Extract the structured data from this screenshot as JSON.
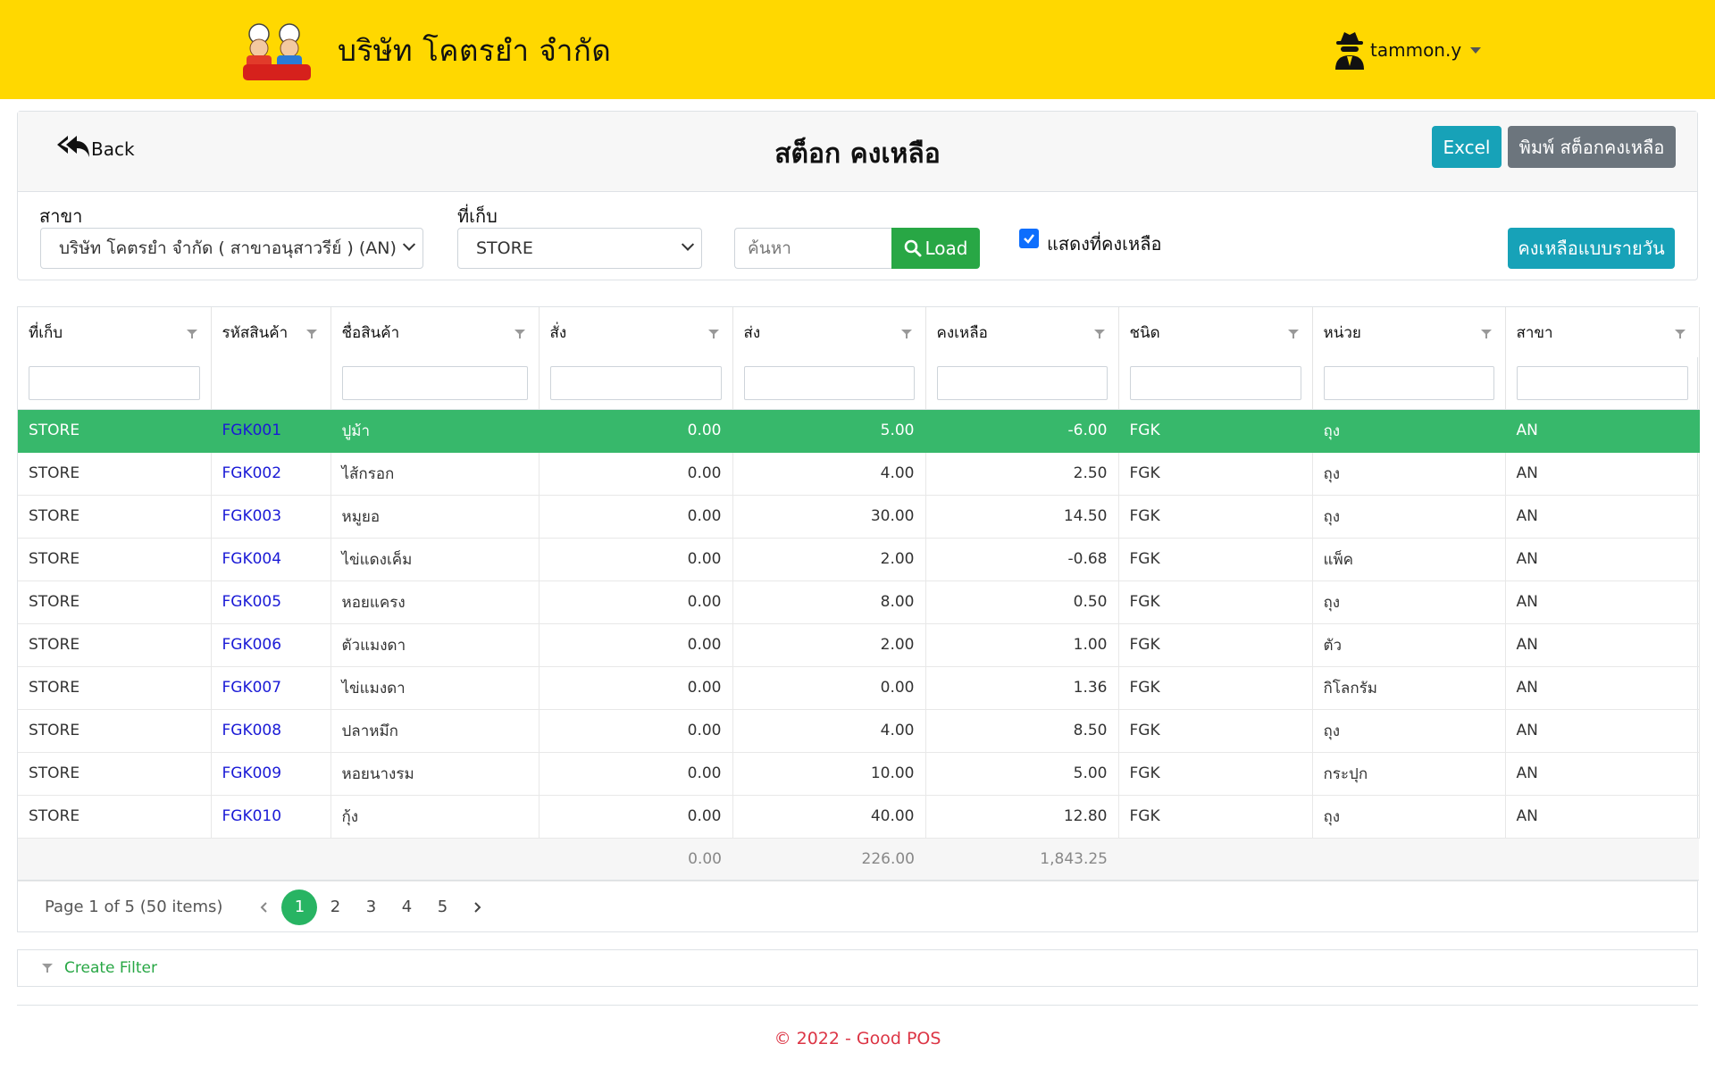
{
  "header": {
    "company_name": "บริษัท โคตรยำ จำกัด",
    "logo_text": "โคตรยำ",
    "user_name": "tammon.y"
  },
  "toolbar": {
    "back_label": "Back",
    "title": "สต็อก คงเหลือ",
    "excel_label": "Excel",
    "print_label": "พิมพ์ สต็อกคงเหลือ"
  },
  "filters": {
    "branch_label": "สาขา",
    "branch_value": "บริษัท โคตรยำ จำกัด ( สาขาอนุสาวรีย์ ) (AN)",
    "store_label": "ที่เก็บ",
    "store_value": "STORE",
    "search_placeholder": "ค้นหา",
    "load_label": "Load",
    "show_remaining_label": "แสดงที่คงเหลือ",
    "show_remaining_checked": true,
    "daily_label": "คงเหลือแบบรายวัน"
  },
  "table": {
    "columns": [
      "ที่เก็บ",
      "รหัสสินค้า",
      "ชื่อสินค้า",
      "สั่ง",
      "ส่ง",
      "คงเหลือ",
      "ชนิด",
      "หน่วย",
      "สาขา"
    ],
    "rows": [
      [
        "STORE",
        "FGK001",
        "ปูม้า",
        "0.00",
        "5.00",
        "-6.00",
        "FGK",
        "ถุง",
        "AN"
      ],
      [
        "STORE",
        "FGK002",
        "ไส้กรอก",
        "0.00",
        "4.00",
        "2.50",
        "FGK",
        "ถุง",
        "AN"
      ],
      [
        "STORE",
        "FGK003",
        "หมูยอ",
        "0.00",
        "30.00",
        "14.50",
        "FGK",
        "ถุง",
        "AN"
      ],
      [
        "STORE",
        "FGK004",
        "ไข่แดงเค็ม",
        "0.00",
        "2.00",
        "-0.68",
        "FGK",
        "แพ็ค",
        "AN"
      ],
      [
        "STORE",
        "FGK005",
        "หอยแครง",
        "0.00",
        "8.00",
        "0.50",
        "FGK",
        "ถุง",
        "AN"
      ],
      [
        "STORE",
        "FGK006",
        "ตัวแมงดา",
        "0.00",
        "2.00",
        "1.00",
        "FGK",
        "ตัว",
        "AN"
      ],
      [
        "STORE",
        "FGK007",
        "ไข่แมงดา",
        "0.00",
        "0.00",
        "1.36",
        "FGK",
        "กิโลกรัม",
        "AN"
      ],
      [
        "STORE",
        "FGK008",
        "ปลาหมึก",
        "0.00",
        "4.00",
        "8.50",
        "FGK",
        "ถุง",
        "AN"
      ],
      [
        "STORE",
        "FGK009",
        "หอยนางรม",
        "0.00",
        "10.00",
        "5.00",
        "FGK",
        "กระปุก",
        "AN"
      ],
      [
        "STORE",
        "FGK010",
        "กุ้ง",
        "0.00",
        "40.00",
        "12.80",
        "FGK",
        "ถุง",
        "AN"
      ]
    ],
    "totals": {
      "order": "0.00",
      "delivered": "226.00",
      "remaining": "1,843.25"
    }
  },
  "pager": {
    "info": "Page 1 of 5 (50 items)",
    "pages": [
      "1",
      "2",
      "3",
      "4",
      "5"
    ],
    "current": "1"
  },
  "filter_builder": {
    "label": "Create Filter"
  },
  "footer": {
    "text": "© 2022 - Good POS"
  },
  "colors": {
    "topbar": "#ffd800",
    "selected_row": "#37b86b",
    "info_button": "#17a2b8",
    "secondary_button": "#6c757d",
    "success": "#28a745",
    "link": "#1a1ad6",
    "footer_text": "#dc3545"
  }
}
